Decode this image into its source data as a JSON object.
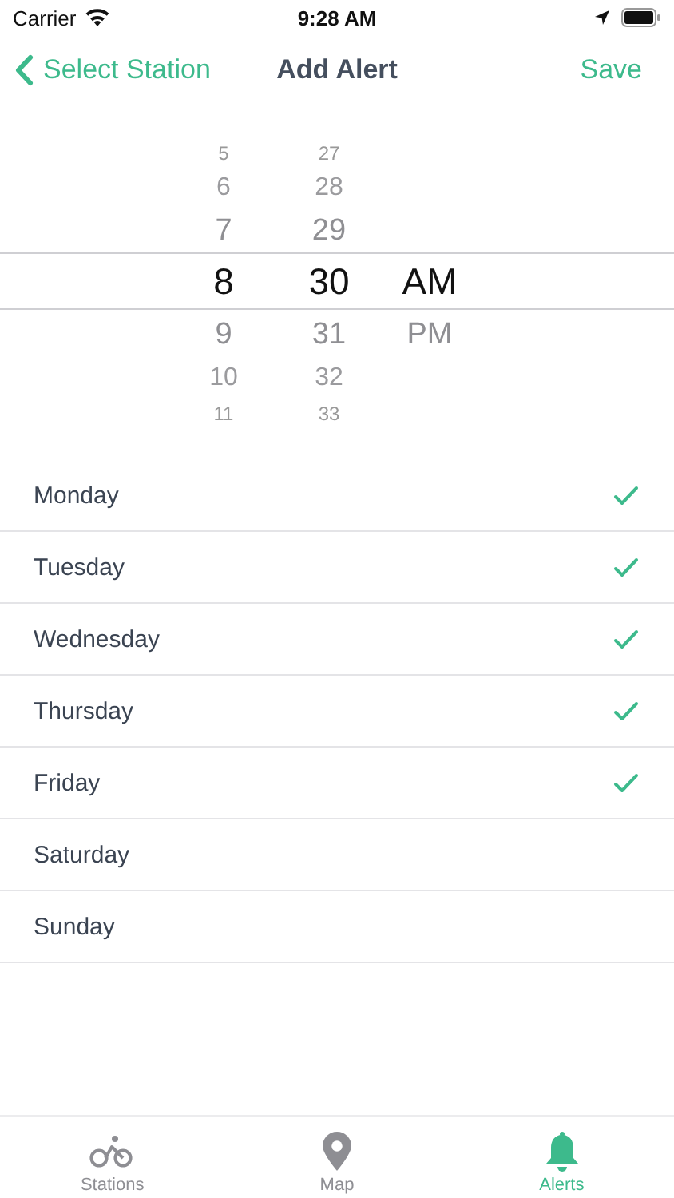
{
  "status_bar": {
    "carrier": "Carrier",
    "time": "9:28 AM"
  },
  "nav_bar": {
    "back": "Select Station",
    "title": "Add Alert",
    "action": "Save"
  },
  "time_picker": {
    "columns": [
      {
        "items": [
          {
            "label": "5",
            "selected": false
          },
          {
            "label": "6",
            "selected": false
          },
          {
            "label": "7",
            "selected": false
          },
          {
            "label": "8",
            "selected": true
          },
          {
            "label": "9",
            "selected": false
          },
          {
            "label": "10",
            "selected": false
          },
          {
            "label": "11",
            "selected": false
          }
        ]
      },
      {
        "items": [
          {
            "label": "27",
            "selected": false
          },
          {
            "label": "28",
            "selected": false
          },
          {
            "label": "29",
            "selected": false
          },
          {
            "label": "30",
            "selected": true
          },
          {
            "label": "31",
            "selected": false
          },
          {
            "label": "32",
            "selected": false
          },
          {
            "label": "33",
            "selected": false
          }
        ]
      },
      {
        "items": [
          {
            "label": "AM",
            "selected": true
          },
          {
            "label": "PM",
            "selected": false
          }
        ]
      }
    ]
  },
  "days": [
    {
      "label": "Monday",
      "checked": true
    },
    {
      "label": "Tuesday",
      "checked": true
    },
    {
      "label": "Wednesday",
      "checked": true
    },
    {
      "label": "Thursday",
      "checked": true
    },
    {
      "label": "Friday",
      "checked": true
    },
    {
      "label": "Saturday",
      "checked": false
    },
    {
      "label": "Sunday",
      "checked": false
    }
  ],
  "tab_bar": [
    {
      "kind": "bike",
      "label": "Stations",
      "selected": false
    },
    {
      "kind": "pin",
      "label": "Map",
      "selected": false
    },
    {
      "kind": "bell",
      "label": "Alerts",
      "selected": true
    }
  ]
}
